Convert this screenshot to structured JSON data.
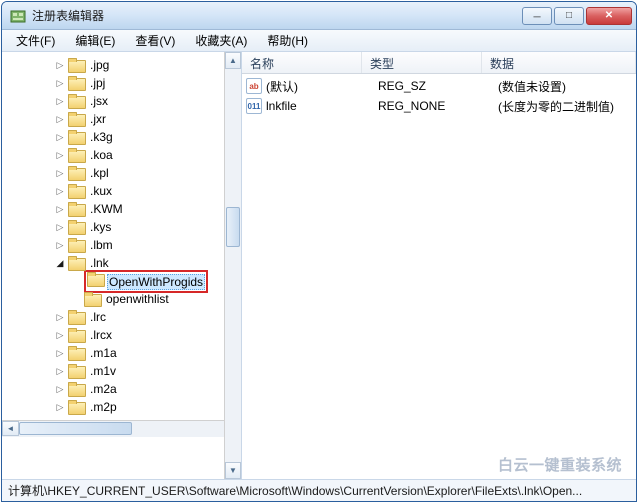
{
  "window": {
    "title": "注册表编辑器"
  },
  "menu": {
    "file": "文件(F)",
    "edit": "编辑(E)",
    "view": "查看(V)",
    "favorites": "收藏夹(A)",
    "help": "帮助(H)"
  },
  "tree": {
    "items": [
      {
        "label": ".jpg",
        "depth": 3,
        "expanded": false
      },
      {
        "label": ".jpj",
        "depth": 3,
        "expanded": false
      },
      {
        "label": ".jsx",
        "depth": 3,
        "expanded": false
      },
      {
        "label": ".jxr",
        "depth": 3,
        "expanded": false
      },
      {
        "label": ".k3g",
        "depth": 3,
        "expanded": false
      },
      {
        "label": ".koa",
        "depth": 3,
        "expanded": false
      },
      {
        "label": ".kpl",
        "depth": 3,
        "expanded": false
      },
      {
        "label": ".kux",
        "depth": 3,
        "expanded": false
      },
      {
        "label": ".KWM",
        "depth": 3,
        "expanded": false
      },
      {
        "label": ".kys",
        "depth": 3,
        "expanded": false
      },
      {
        "label": ".lbm",
        "depth": 3,
        "expanded": false
      },
      {
        "label": ".lnk",
        "depth": 3,
        "expanded": true
      },
      {
        "label": "OpenWithProgids",
        "depth": 4,
        "expanded": null,
        "selected": true,
        "highlighted": true
      },
      {
        "label": "openwithlist",
        "depth": 4,
        "expanded": null
      },
      {
        "label": ".lrc",
        "depth": 3,
        "expanded": false
      },
      {
        "label": ".lrcx",
        "depth": 3,
        "expanded": false
      },
      {
        "label": ".m1a",
        "depth": 3,
        "expanded": false
      },
      {
        "label": ".m1v",
        "depth": 3,
        "expanded": false
      },
      {
        "label": ".m2a",
        "depth": 3,
        "expanded": false
      },
      {
        "label": ".m2p",
        "depth": 3,
        "expanded": false
      }
    ]
  },
  "list": {
    "columns": {
      "name": "名称",
      "type": "类型",
      "data": "数据"
    },
    "rows": [
      {
        "icon": "sz",
        "icon_text": "ab",
        "name": "(默认)",
        "type": "REG_SZ",
        "data": "(数值未设置)"
      },
      {
        "icon": "bin",
        "icon_text": "011",
        "name": "lnkfile",
        "type": "REG_NONE",
        "data": "(长度为零的二进制值)"
      }
    ]
  },
  "statusbar": {
    "prefix": "计算机",
    "path": "\\HKEY_CURRENT_USER\\Software\\Microsoft\\Windows\\CurrentVersion\\Explorer\\FileExts\\.lnk\\Open..."
  },
  "watermark": "白云一键重装系统"
}
